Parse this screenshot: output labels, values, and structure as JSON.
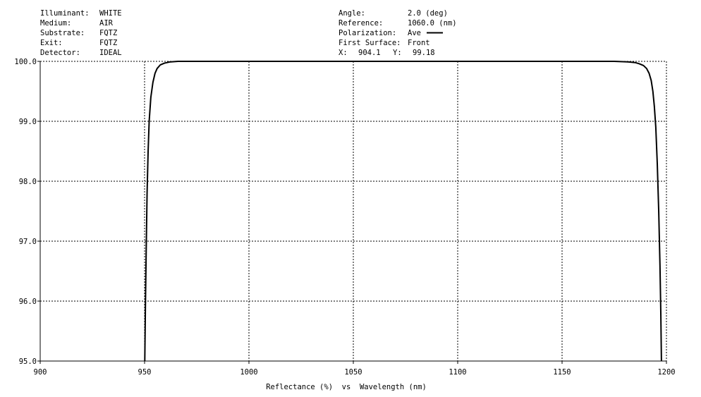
{
  "header": {
    "left": [
      {
        "label": "Illuminant:",
        "value": "WHITE"
      },
      {
        "label": "Medium:",
        "value": "AIR"
      },
      {
        "label": "Substrate:",
        "value": "FQTZ"
      },
      {
        "label": "Exit:",
        "value": "FQTZ"
      },
      {
        "label": "Detector:",
        "value": "IDEAL"
      }
    ],
    "right": [
      {
        "label": "Angle:",
        "value": "2.0 (deg)"
      },
      {
        "label": "Reference:",
        "value": "1060.0 (nm)"
      },
      {
        "label": "Polarization:",
        "value": "Ave"
      },
      {
        "label": "First Surface:",
        "value": "Front"
      }
    ],
    "cursor": {
      "x_label": "X:",
      "x_value": "904.1",
      "y_label": "Y:",
      "y_value": "99.18"
    }
  },
  "chart_data": {
    "type": "line",
    "xlabel": "Reflectance (%)  vs  Wavelength (nm)",
    "xlim": [
      900,
      1200
    ],
    "ylim": [
      95,
      100
    ],
    "x_ticks": [
      900,
      950,
      1000,
      1050,
      1100,
      1150,
      1200
    ],
    "x_tick_labels": [
      "900",
      "950",
      "1000",
      "1050",
      "1100",
      "1150",
      "1200"
    ],
    "y_ticks": [
      95,
      96,
      97,
      98,
      99,
      100
    ],
    "y_tick_labels": [
      "95.0",
      "96.0",
      "97.0",
      "98.0",
      "99.0",
      "100.0"
    ],
    "grid": true,
    "line_color": "#000000",
    "series": [
      {
        "name": "Ave",
        "x": [
          950.1,
          950.4,
          950.8,
          951.2,
          951.7,
          952.2,
          953.0,
          954.0,
          955.0,
          956.0,
          957.5,
          959.5,
          962.0,
          966.0,
          975.0,
          1000,
          1050,
          1100,
          1150,
          1175,
          1182,
          1185,
          1187,
          1189,
          1190.5,
          1191.7,
          1192.7,
          1193.5,
          1194.2,
          1194.9,
          1195.6,
          1196.3,
          1196.9,
          1197.3,
          1197.6
        ],
        "y": [
          95.0,
          95.9,
          96.9,
          97.8,
          98.5,
          99.0,
          99.4,
          99.65,
          99.8,
          99.88,
          99.94,
          99.97,
          99.99,
          100.0,
          100.0,
          100.0,
          100.0,
          100.0,
          100.0,
          100.0,
          99.99,
          99.98,
          99.96,
          99.93,
          99.88,
          99.8,
          99.68,
          99.5,
          99.25,
          98.9,
          98.3,
          97.5,
          96.6,
          95.8,
          95.0
        ]
      }
    ]
  }
}
